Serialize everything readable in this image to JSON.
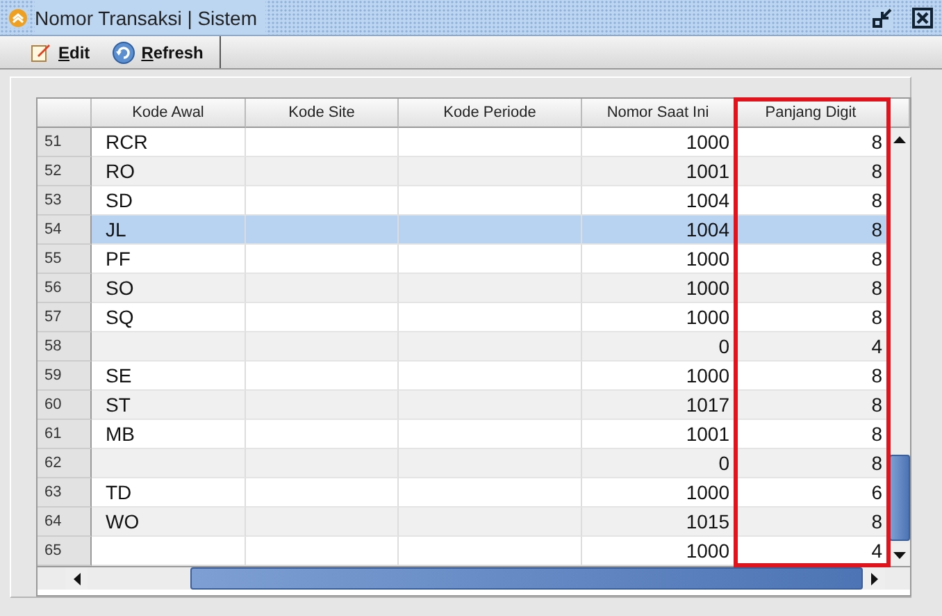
{
  "window": {
    "title": "Nomor Transaksi | Sistem"
  },
  "toolbar": [
    {
      "label": "Edit",
      "kind": "edit"
    },
    {
      "label": "Refresh",
      "kind": "refresh"
    }
  ],
  "table": {
    "columns": [
      {
        "label": "Kode Awal",
        "kind": "text",
        "highlighted": false
      },
      {
        "label": "Kode Site",
        "kind": "text",
        "highlighted": false
      },
      {
        "label": "Kode Periode",
        "kind": "text",
        "highlighted": false
      },
      {
        "label": "Nomor Saat Ini",
        "kind": "number",
        "highlighted": false
      },
      {
        "label": "Panjang Digit",
        "kind": "number",
        "highlighted": true
      }
    ],
    "rows": [
      {
        "number": "51",
        "cells": [
          "RCR",
          "",
          "",
          "1000",
          "8"
        ],
        "selected": false
      },
      {
        "number": "52",
        "cells": [
          "RO",
          "",
          "",
          "1001",
          "8"
        ],
        "selected": false
      },
      {
        "number": "53",
        "cells": [
          "SD",
          "",
          "",
          "1004",
          "8"
        ],
        "selected": false
      },
      {
        "number": "54",
        "cells": [
          "JL",
          "",
          "",
          "1004",
          "8"
        ],
        "selected": true
      },
      {
        "number": "55",
        "cells": [
          "PF",
          "",
          "",
          "1000",
          "8"
        ],
        "selected": false
      },
      {
        "number": "56",
        "cells": [
          "SO",
          "",
          "",
          "1000",
          "8"
        ],
        "selected": false
      },
      {
        "number": "57",
        "cells": [
          "SQ",
          "",
          "",
          "1000",
          "8"
        ],
        "selected": false
      },
      {
        "number": "58",
        "cells": [
          "",
          "",
          "",
          "0",
          "4"
        ],
        "selected": false
      },
      {
        "number": "59",
        "cells": [
          "SE",
          "",
          "",
          "1000",
          "8"
        ],
        "selected": false
      },
      {
        "number": "60",
        "cells": [
          "ST",
          "",
          "",
          "1017",
          "8"
        ],
        "selected": false
      },
      {
        "number": "61",
        "cells": [
          "MB",
          "",
          "",
          "1001",
          "8"
        ],
        "selected": false
      },
      {
        "number": "62",
        "cells": [
          "",
          "",
          "",
          "0",
          "8"
        ],
        "selected": false
      },
      {
        "number": "63",
        "cells": [
          "TD",
          "",
          "",
          "1000",
          "6"
        ],
        "selected": false
      },
      {
        "number": "64",
        "cells": [
          "WO",
          "",
          "",
          "1015",
          "8"
        ],
        "selected": false
      },
      {
        "number": "65",
        "cells": [
          "",
          "",
          "",
          "1000",
          "4"
        ],
        "selected": false
      }
    ]
  }
}
